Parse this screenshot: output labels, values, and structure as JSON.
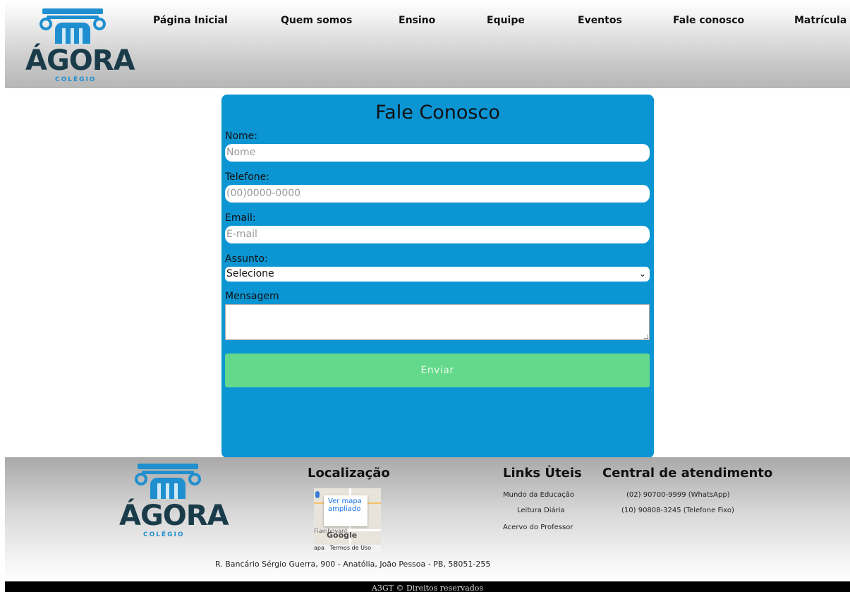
{
  "header": {
    "logo": {
      "name": "ÁGORA",
      "subtitle": "COLÉGIO"
    },
    "nav": [
      {
        "label": "Página Inicial"
      },
      {
        "label": "Quem somos"
      },
      {
        "label": "Ensino"
      },
      {
        "label": "Equipe"
      },
      {
        "label": "Eventos"
      },
      {
        "label": "Fale conosco"
      },
      {
        "label": "Matrícula"
      }
    ]
  },
  "form": {
    "title": "Fale Conosco",
    "nome": {
      "label": "Nome:",
      "placeholder": "Nome"
    },
    "telefone": {
      "label": "Telefone:",
      "placeholder": "(00)0000-0000"
    },
    "email": {
      "label": "Email:",
      "placeholder": "E-mail"
    },
    "assunto": {
      "label": "Assunto:",
      "value": "Selecione"
    },
    "mensagem": {
      "label": "Mensagem"
    },
    "submit_label": "Enviar"
  },
  "footer": {
    "logo": {
      "name": "ÁGORA",
      "subtitle": "COLÉGIO"
    },
    "location": {
      "heading": "Localização",
      "map": {
        "link_label": "Ver mapa ampliado",
        "brand": "Google",
        "place": "Flamboyant",
        "bar_left": "apa",
        "terms": "Termos de Uso"
      },
      "address": "R. Bancário Sérgio Guerra, 900 - Anatólia, João Pessoa - PB, 58051-255"
    },
    "links": {
      "heading": "Links Ùteis",
      "items": [
        "Mundo da Educação",
        "Leitura Diária",
        "Acervo do Professor"
      ]
    },
    "support": {
      "heading": "Central de atendimento",
      "items": [
        "(02) 90700-9999 (WhatsApp)",
        "(10) 90808-3245 (Telefone Fixo)"
      ]
    }
  },
  "copyright": "A3GT © Direitos reservados",
  "colors": {
    "panel": "#0b95d3",
    "button": "#64d98b",
    "brand_blue": "#1f8fd0",
    "brand_dark": "#1a3c4a"
  }
}
